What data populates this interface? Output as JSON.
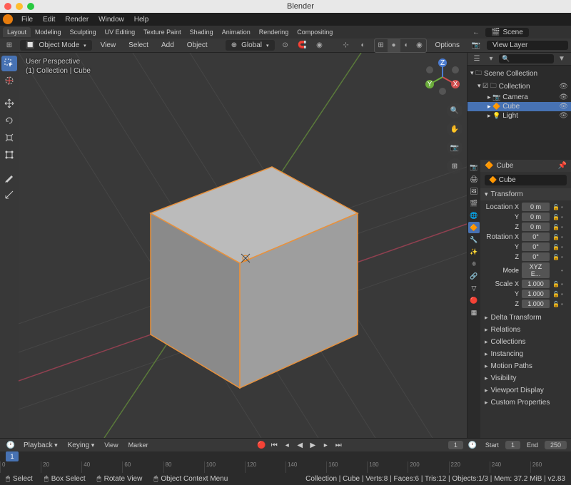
{
  "title": "Blender",
  "menu": [
    "File",
    "Edit",
    "Render",
    "Window",
    "Help"
  ],
  "workspaces": [
    "Layout",
    "Modeling",
    "Sculpting",
    "UV Editing",
    "Texture Paint",
    "Shading",
    "Animation",
    "Rendering",
    "Compositing"
  ],
  "scene": {
    "scene_label": "Scene",
    "layer_label": "View Layer"
  },
  "viewport": {
    "mode": "Object Mode",
    "menus": [
      "View",
      "Select",
      "Add",
      "Object"
    ],
    "orient": "Global",
    "options": "Options",
    "info1": "User Perspective",
    "info2": "(1) Collection | Cube"
  },
  "outliner": {
    "search_placeholder": "",
    "root": "Scene Collection",
    "collection": "Collection",
    "items": [
      "Camera",
      "Cube",
      "Light"
    ]
  },
  "properties": {
    "object_label": "Cube",
    "name_field": "Cube",
    "transform_panel": "Transform",
    "location": {
      "label": "Location",
      "x": "0 m",
      "y": "0 m",
      "z": "0 m"
    },
    "rotation": {
      "label": "Rotation",
      "x": "0°",
      "y": "0°",
      "z": "0°"
    },
    "mode": {
      "label": "Mode",
      "value": "XYZ E..."
    },
    "scale": {
      "label": "Scale",
      "x": "1.000",
      "y": "1.000",
      "z": "1.000"
    },
    "panels": [
      "Delta Transform",
      "Relations",
      "Collections",
      "Instancing",
      "Motion Paths",
      "Visibility",
      "Viewport Display",
      "Custom Properties"
    ]
  },
  "timeline": {
    "menus": [
      "Playback",
      "Keying",
      "View",
      "Marker"
    ],
    "current": "1",
    "start_lbl": "Start",
    "start": "1",
    "end_lbl": "End",
    "end": "250",
    "playhead": "1",
    "ticks": [
      "0",
      "20",
      "40",
      "60",
      "80",
      "100",
      "120",
      "140",
      "160",
      "180",
      "200",
      "220",
      "240",
      "260"
    ]
  },
  "status": {
    "select": "Select",
    "box": "Box Select",
    "rotate": "Rotate View",
    "context": "Object Context Menu",
    "info": "Collection | Cube | Verts:8 | Faces:6 | Tris:12 | Objects:1/3 | Mem: 37.2 MiB | v2.83"
  }
}
